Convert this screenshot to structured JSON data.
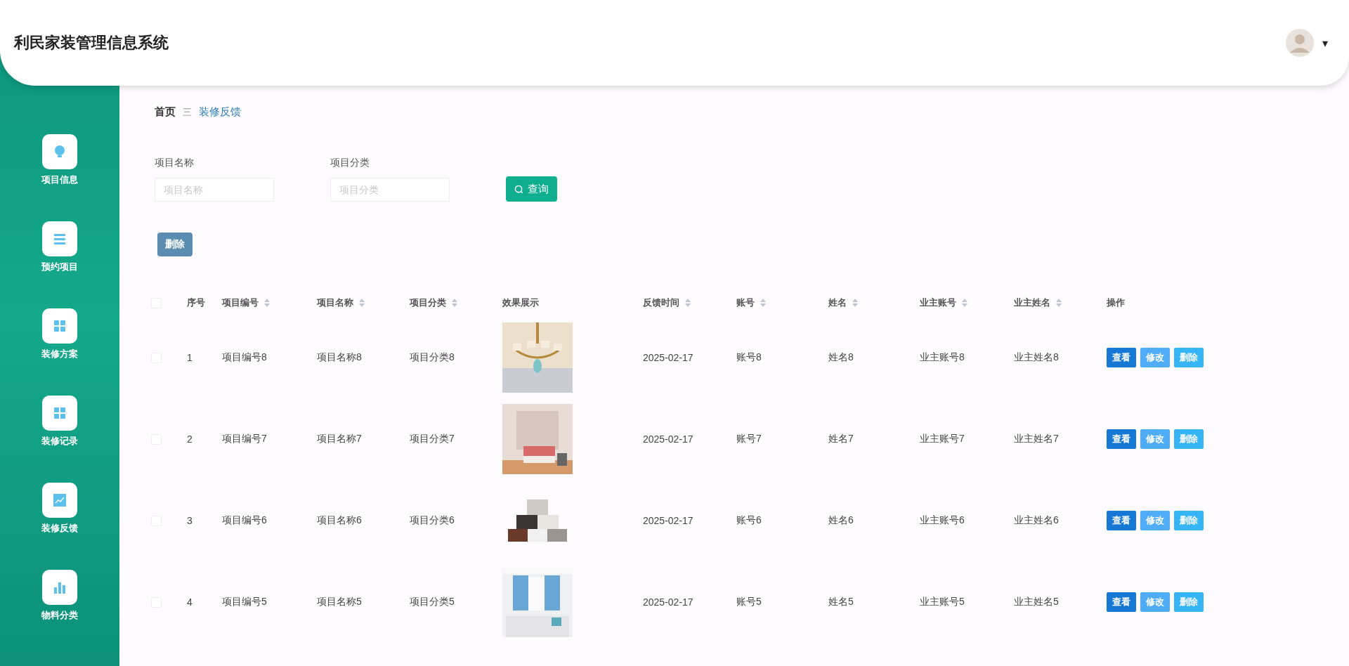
{
  "app_title": "利民家装管理信息系统",
  "user_menu": {
    "caret": "▾"
  },
  "sidebar": {
    "items": [
      {
        "label": "项目信息"
      },
      {
        "label": "预约项目"
      },
      {
        "label": "装修方案"
      },
      {
        "label": "装修记录"
      },
      {
        "label": "装修反馈"
      },
      {
        "label": "物料分类"
      }
    ]
  },
  "breadcrumb": {
    "home": "首页",
    "separator": "三",
    "current": "装修反馈"
  },
  "filters": [
    {
      "label": "项目名称",
      "placeholder": "项目名称"
    },
    {
      "label": "项目分类",
      "placeholder": "项目分类"
    }
  ],
  "search_button": "查询",
  "bulk_delete_button": "删除",
  "table": {
    "header_checked": false,
    "columns": [
      {
        "label": "序号",
        "sortable": false
      },
      {
        "label": "项目编号",
        "sortable": true
      },
      {
        "label": "项目名称",
        "sortable": true
      },
      {
        "label": "项目分类",
        "sortable": true
      },
      {
        "label": "效果展示",
        "sortable": false
      },
      {
        "label": "反馈时间",
        "sortable": true
      },
      {
        "label": "账号",
        "sortable": true
      },
      {
        "label": "姓名",
        "sortable": true
      },
      {
        "label": "业主账号",
        "sortable": true
      },
      {
        "label": "业主姓名",
        "sortable": true
      },
      {
        "label": "操作",
        "sortable": false
      }
    ],
    "rows": [
      {
        "checked": false,
        "cells": [
          "1",
          "项目编号8",
          "项目名称8",
          "项目分类8",
          "",
          "2025-02-17",
          "账号8",
          "姓名8",
          "业主账号8",
          "业主姓名8"
        ],
        "actions": [
          {
            "label": "查看",
            "kind": "view"
          },
          {
            "label": "修改",
            "kind": "edit"
          },
          {
            "label": "删除",
            "kind": "delete"
          }
        ]
      },
      {
        "checked": false,
        "cells": [
          "2",
          "项目编号7",
          "项目名称7",
          "项目分类7",
          "",
          "2025-02-17",
          "账号7",
          "姓名7",
          "业主账号7",
          "业主姓名7"
        ],
        "actions": [
          {
            "label": "查看",
            "kind": "view"
          },
          {
            "label": "修改",
            "kind": "edit"
          },
          {
            "label": "删除",
            "kind": "delete"
          }
        ]
      },
      {
        "checked": false,
        "cells": [
          "3",
          "项目编号6",
          "项目名称6",
          "项目分类6",
          "",
          "2025-02-17",
          "账号6",
          "姓名6",
          "业主账号6",
          "业主姓名6"
        ],
        "actions": [
          {
            "label": "查看",
            "kind": "view"
          },
          {
            "label": "修改",
            "kind": "edit"
          },
          {
            "label": "删除",
            "kind": "delete"
          }
        ]
      },
      {
        "checked": false,
        "cells": [
          "4",
          "项目编号5",
          "项目名称5",
          "项目分类5",
          "",
          "2025-02-17",
          "账号5",
          "姓名5",
          "业主账号5",
          "业主姓名5"
        ],
        "actions": [
          {
            "label": "查看",
            "kind": "view"
          },
          {
            "label": "修改",
            "kind": "edit"
          },
          {
            "label": "删除",
            "kind": "delete"
          }
        ]
      }
    ]
  }
}
